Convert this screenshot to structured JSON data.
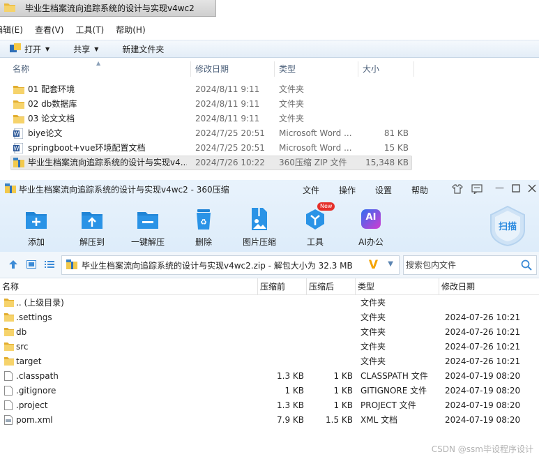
{
  "explorer": {
    "window_title": "毕业生档案流向追踪系统的设计与实现v4wc2",
    "menu": [
      "编辑(E)",
      "查看(V)",
      "工具(T)",
      "帮助(H)"
    ],
    "toolbar": {
      "open_label": "打开",
      "share_label": "共享",
      "new_folder_label": "新建文件夹"
    },
    "columns": [
      "名称",
      "修改日期",
      "类型",
      "大小"
    ],
    "rows": [
      {
        "name": "01 配套环境",
        "date": "2024/8/11 9:11",
        "type": "文件夹",
        "size": "",
        "icon": "folder-icon"
      },
      {
        "name": "02 db数据库",
        "date": "2024/8/11 9:11",
        "type": "文件夹",
        "size": "",
        "icon": "folder-icon"
      },
      {
        "name": "03 论文文档",
        "date": "2024/8/11 9:11",
        "type": "文件夹",
        "size": "",
        "icon": "folder-icon"
      },
      {
        "name": "biye论文",
        "date": "2024/7/25 20:51",
        "type": "Microsoft Word ...",
        "size": "81 KB",
        "icon": "word-doc-icon"
      },
      {
        "name": "springboot+vue环境配置文档",
        "date": "2024/7/25 20:51",
        "type": "Microsoft Word ...",
        "size": "15 KB",
        "icon": "word-doc-icon"
      },
      {
        "name": "毕业生档案流向追踪系统的设计与实现v4...",
        "date": "2024/7/26 10:22",
        "type": "360压缩 ZIP 文件",
        "size": "15,348 KB",
        "icon": "zip-archive-icon",
        "selected": true
      }
    ]
  },
  "zip360": {
    "window_title": "毕业生档案流向追踪系统的设计与实现v4wc2 - 360压缩",
    "menu": [
      "文件",
      "操作",
      "设置",
      "帮助"
    ],
    "tools": [
      {
        "label": "添加",
        "icon": "add-icon"
      },
      {
        "label": "解压到",
        "icon": "extract-to-icon"
      },
      {
        "label": "一键解压",
        "icon": "one-click-extract-icon"
      },
      {
        "label": "删除",
        "icon": "recycle-bin-icon"
      },
      {
        "label": "图片压缩",
        "icon": "image-compress-icon"
      },
      {
        "label": "工具",
        "icon": "tools-icon",
        "badge": "New"
      },
      {
        "label": "AI办公",
        "icon": "ai-office-icon",
        "icon_text": "AI"
      }
    ],
    "scan_label": "扫描",
    "address": "毕业生档案流向追踪系统的设计与实现v4wc2.zip - 解包大小为 32.3 MB",
    "search_placeholder": "搜索包内文件",
    "columns": [
      "名称",
      "压缩前",
      "压缩后",
      "类型",
      "修改日期"
    ],
    "rows": [
      {
        "name": ".. (上级目录)",
        "before": "",
        "after": "",
        "type": "文件夹",
        "date": "",
        "icon": "folder-icon"
      },
      {
        "name": ".settings",
        "before": "",
        "after": "",
        "type": "文件夹",
        "date": "2024-07-26 10:21",
        "icon": "folder-icon"
      },
      {
        "name": "db",
        "before": "",
        "after": "",
        "type": "文件夹",
        "date": "2024-07-26 10:21",
        "icon": "folder-icon"
      },
      {
        "name": "src",
        "before": "",
        "after": "",
        "type": "文件夹",
        "date": "2024-07-26 10:21",
        "icon": "folder-icon"
      },
      {
        "name": "target",
        "before": "",
        "after": "",
        "type": "文件夹",
        "date": "2024-07-26 10:21",
        "icon": "folder-icon"
      },
      {
        "name": ".classpath",
        "before": "1.3 KB",
        "after": "1 KB",
        "type": "CLASSPATH 文件",
        "date": "2024-07-19 08:20",
        "icon": "file-icon"
      },
      {
        "name": ".gitignore",
        "before": "1 KB",
        "after": "1 KB",
        "type": "GITIGNORE 文件",
        "date": "2024-07-19 08:20",
        "icon": "file-icon"
      },
      {
        "name": ".project",
        "before": "1.3 KB",
        "after": "1 KB",
        "type": "PROJECT 文件",
        "date": "2024-07-19 08:20",
        "icon": "file-icon"
      },
      {
        "name": "pom.xml",
        "before": "7.9 KB",
        "after": "1.5 KB",
        "type": "XML 文档",
        "date": "2024-07-19 08:20",
        "icon": "xml-file-icon"
      }
    ]
  },
  "watermark": "CSDN @ssm毕设程序设计",
  "colors": {
    "folder": "#f2c94c",
    "accent_blue": "#1e88e5",
    "toolbar_bg": "#ddecfa",
    "selection": "#eaeaea"
  }
}
